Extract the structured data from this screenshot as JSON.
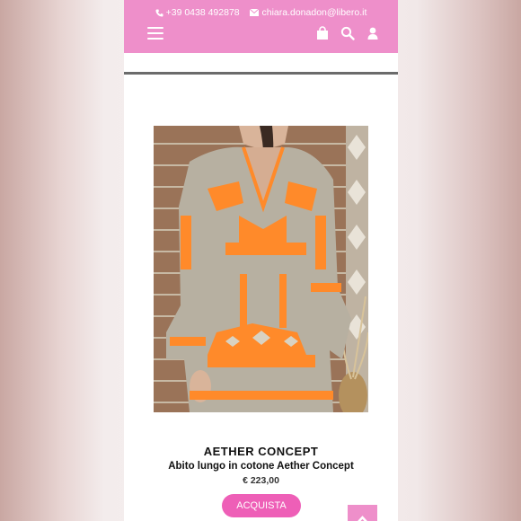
{
  "header": {
    "phone": "+39 0438 492878",
    "email": "chiara.donadon@libero.it",
    "icons": [
      "phone-icon",
      "mail-icon",
      "menu-icon",
      "shopping-bag-icon",
      "search-icon",
      "user-icon"
    ]
  },
  "colors": {
    "header_bg": "#ee8fca",
    "button_bg": "#ee5fb7",
    "dress_accent": "#ff8a2a",
    "dress_base": "#b9b2a3"
  },
  "product": {
    "brand": "AETHER CONCEPT",
    "name": "Abito lungo in cotone Aether Concept",
    "price": "€ 223,00",
    "buy_label": "ACQUISTA"
  }
}
